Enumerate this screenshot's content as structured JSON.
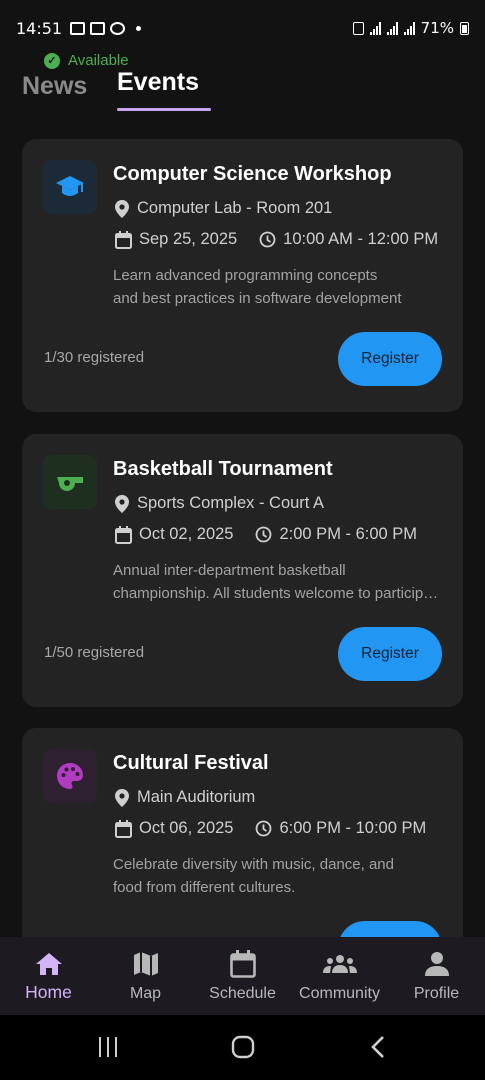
{
  "status_bar": {
    "time": "14:51",
    "battery": "71%"
  },
  "availability": {
    "label": "Available",
    "color": "#4caf50"
  },
  "tabs": [
    {
      "label": "News",
      "active": false
    },
    {
      "label": "Events",
      "active": true
    }
  ],
  "events": [
    {
      "title": "Computer Science Workshop",
      "location": "Computer Lab - Room 201",
      "date": "Sep 25, 2025",
      "time": "10:00 AM - 12:00 PM",
      "description_line1": "Learn advanced programming concepts",
      "description_line2": "and best practices in software development",
      "registered": "1/30 registered",
      "button_label": "Register",
      "icon": "graduation-cap-icon",
      "icon_color": "#2196f3",
      "icon_bg": "#1c2a38"
    },
    {
      "title": "Basketball Tournament",
      "location": "Sports Complex - Court A",
      "date": "Oct 02, 2025",
      "time": "2:00 PM - 6:00 PM",
      "description_line1": "Annual inter-department basketball",
      "description_line2": "championship. All students welcome to participate.",
      "registered": "1/50 registered",
      "button_label": "Register",
      "icon": "whistle-icon",
      "icon_color": "#4caf50",
      "icon_bg": "#1f2f1f"
    },
    {
      "title": "Cultural Festival",
      "location": "Main Auditorium",
      "date": "Oct 06, 2025",
      "time": "6:00 PM - 10:00 PM",
      "description_line1": "Celebrate diversity with music, dance, and",
      "description_line2": "food from different cultures.",
      "registered": "",
      "button_label": "",
      "icon": "palette-icon",
      "icon_color": "#b03cc0",
      "icon_bg": "#2e2031"
    }
  ],
  "bottom_nav": [
    {
      "label": "Home",
      "icon": "home-icon",
      "active": true
    },
    {
      "label": "Map",
      "icon": "map-icon",
      "active": false
    },
    {
      "label": "Schedule",
      "icon": "calendar-icon",
      "active": false
    },
    {
      "label": "Community",
      "icon": "groups-icon",
      "active": false
    },
    {
      "label": "Profile",
      "icon": "person-icon",
      "active": false
    }
  ],
  "colors": {
    "accent": "#2196f3",
    "tab_indicator": "#c8a6f2",
    "card_bg": "#232323",
    "page_bg": "#121212"
  }
}
